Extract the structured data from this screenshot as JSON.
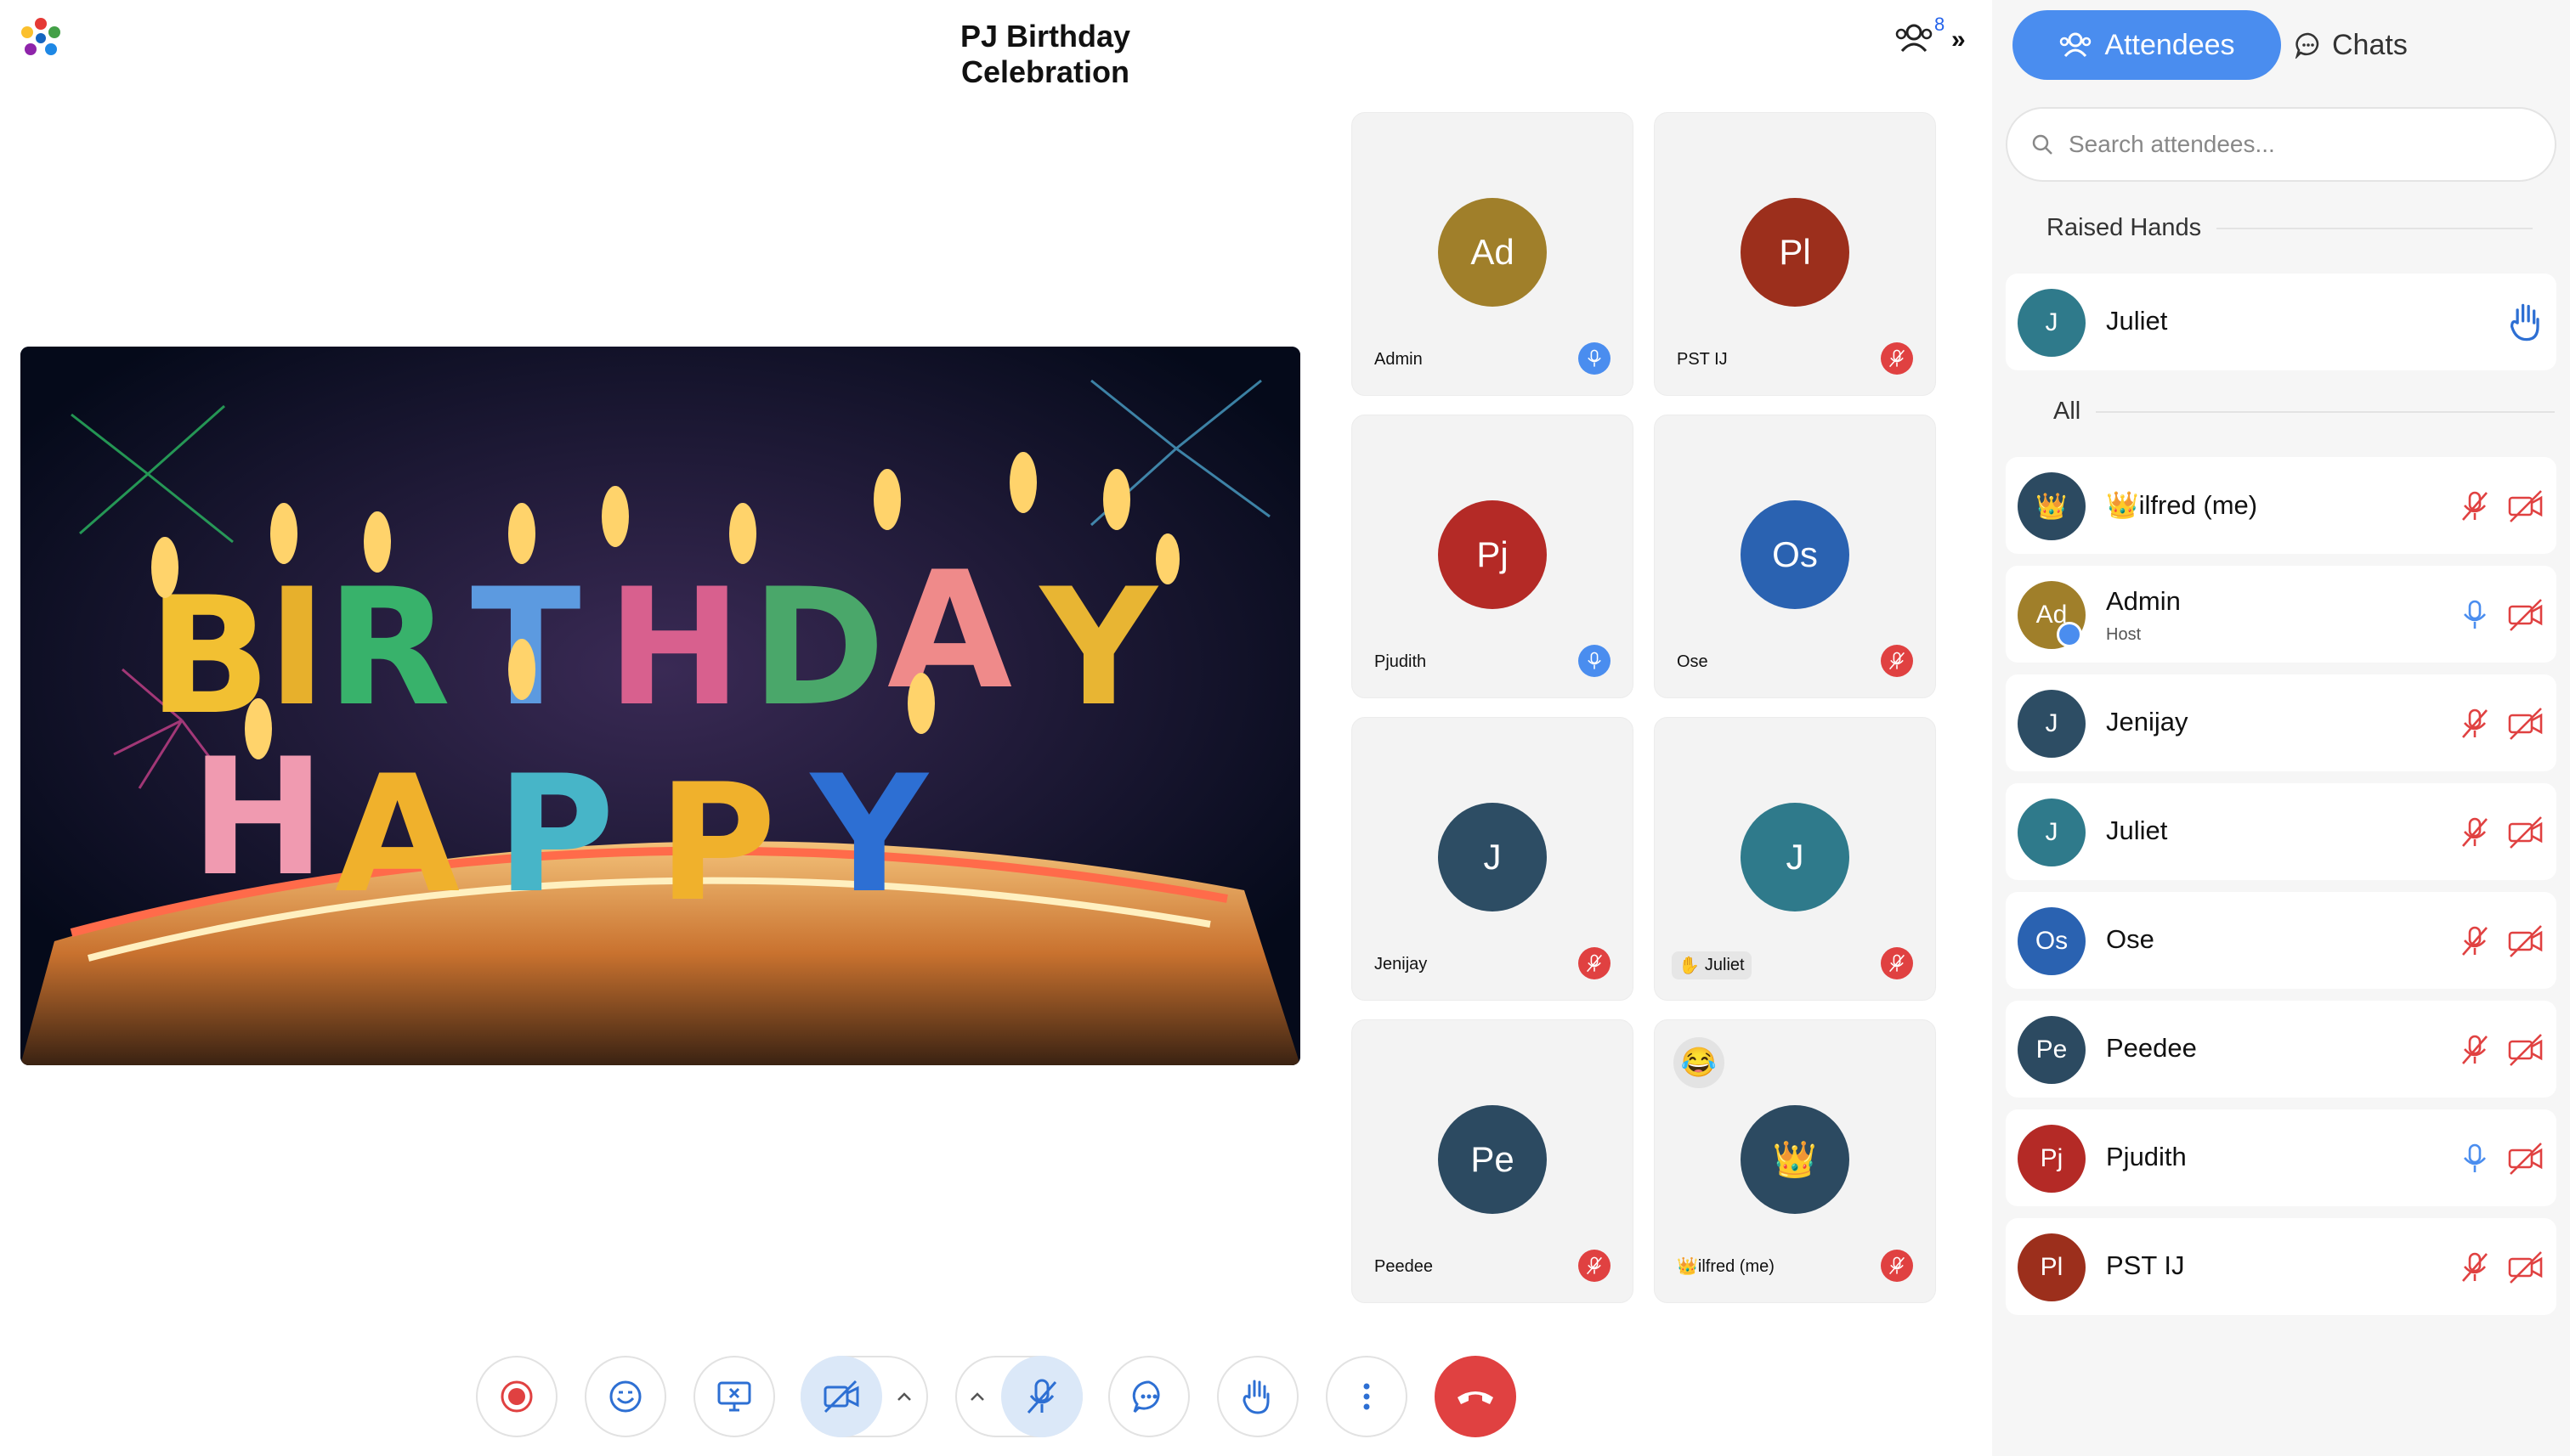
{
  "header": {
    "title": "PJ Birthday Celebration",
    "participant_count": "8"
  },
  "stage": {
    "content": "shared-video",
    "colors": {
      "background": "#050a1a",
      "flame": "#ffd36b"
    }
  },
  "tiles": [
    {
      "initials": "Ad",
      "name": "Admin",
      "avatar_color": "#a07f2a",
      "mic": "on"
    },
    {
      "initials": "Pl",
      "name": "PST IJ",
      "avatar_color": "#9c2f1c",
      "mic": "off"
    },
    {
      "initials": "Pj",
      "name": "Pjudith",
      "avatar_color": "#b42a26",
      "mic": "on"
    },
    {
      "initials": "Os",
      "name": "Ose",
      "avatar_color": "#2a62b1",
      "mic": "off"
    },
    {
      "initials": "J",
      "name": "Jenijay",
      "avatar_color": "#2d4d64",
      "mic": "off"
    },
    {
      "initials": "J",
      "name": "Juliet",
      "avatar_color": "#2f7a8b",
      "mic": "off",
      "hand_raised": true
    },
    {
      "initials": "Pe",
      "name": "Peedee",
      "avatar_color": "#2c4a61",
      "mic": "off"
    },
    {
      "initials": "👑",
      "name": "👑ilfred (me)",
      "avatar_color": "#2c4a61",
      "mic": "off",
      "reaction": "😂"
    }
  ],
  "toolbar": {
    "buttons": [
      "record-icon",
      "reactions-icon",
      "share-screen-icon",
      "camera-off-icon",
      "mic-off-icon",
      "chat-icon",
      "raise-hand-icon",
      "more-icon",
      "end-call-icon"
    ]
  },
  "panel": {
    "tab_attendees": "Attendees",
    "tab_chats": "Chats",
    "search_placeholder": "Search attendees...",
    "raised_hands_label": "Raised Hands",
    "all_label": "All",
    "raised": [
      {
        "initials": "J",
        "name": "Juliet",
        "avatar_color": "#2f7a8b"
      }
    ],
    "attendees": [
      {
        "initials": "👑",
        "name": "👑ilfred (me)",
        "avatar_color": "#2c4a61",
        "mic": "off",
        "cam": "off"
      },
      {
        "initials": "Ad",
        "name": "Admin",
        "role": "Host",
        "avatar_color": "#a07f2a",
        "mic": "on",
        "cam": "off"
      },
      {
        "initials": "J",
        "name": "Jenijay",
        "avatar_color": "#2d4d64",
        "mic": "off",
        "cam": "off"
      },
      {
        "initials": "J",
        "name": "Juliet",
        "avatar_color": "#2f7a8b",
        "mic": "off",
        "cam": "off"
      },
      {
        "initials": "Os",
        "name": "Ose",
        "avatar_color": "#2a62b1",
        "mic": "off",
        "cam": "off"
      },
      {
        "initials": "Pe",
        "name": "Peedee",
        "avatar_color": "#2c4a61",
        "mic": "off",
        "cam": "off"
      },
      {
        "initials": "Pj",
        "name": "Pjudith",
        "avatar_color": "#b42a26",
        "mic": "on",
        "cam": "off"
      },
      {
        "initials": "Pl",
        "name": "PST IJ",
        "avatar_color": "#9c2f1c",
        "mic": "off",
        "cam": "off"
      }
    ]
  },
  "colors": {
    "accent": "#4a8def",
    "mic_on": "#4a8def",
    "mic_off": "#e04141",
    "end_call": "#e04141"
  }
}
